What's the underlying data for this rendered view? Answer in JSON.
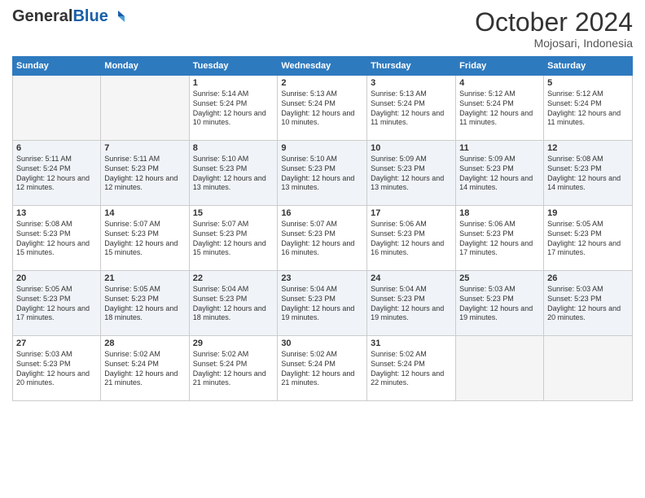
{
  "header": {
    "logo_general": "General",
    "logo_blue": "Blue",
    "month": "October 2024",
    "location": "Mojosari, Indonesia"
  },
  "days_of_week": [
    "Sunday",
    "Monday",
    "Tuesday",
    "Wednesday",
    "Thursday",
    "Friday",
    "Saturday"
  ],
  "weeks": [
    [
      {
        "day": "",
        "sunrise": "",
        "sunset": "",
        "daylight": ""
      },
      {
        "day": "",
        "sunrise": "",
        "sunset": "",
        "daylight": ""
      },
      {
        "day": "1",
        "sunrise": "Sunrise: 5:14 AM",
        "sunset": "Sunset: 5:24 PM",
        "daylight": "Daylight: 12 hours and 10 minutes."
      },
      {
        "day": "2",
        "sunrise": "Sunrise: 5:13 AM",
        "sunset": "Sunset: 5:24 PM",
        "daylight": "Daylight: 12 hours and 10 minutes."
      },
      {
        "day": "3",
        "sunrise": "Sunrise: 5:13 AM",
        "sunset": "Sunset: 5:24 PM",
        "daylight": "Daylight: 12 hours and 11 minutes."
      },
      {
        "day": "4",
        "sunrise": "Sunrise: 5:12 AM",
        "sunset": "Sunset: 5:24 PM",
        "daylight": "Daylight: 12 hours and 11 minutes."
      },
      {
        "day": "5",
        "sunrise": "Sunrise: 5:12 AM",
        "sunset": "Sunset: 5:24 PM",
        "daylight": "Daylight: 12 hours and 11 minutes."
      }
    ],
    [
      {
        "day": "6",
        "sunrise": "Sunrise: 5:11 AM",
        "sunset": "Sunset: 5:24 PM",
        "daylight": "Daylight: 12 hours and 12 minutes."
      },
      {
        "day": "7",
        "sunrise": "Sunrise: 5:11 AM",
        "sunset": "Sunset: 5:23 PM",
        "daylight": "Daylight: 12 hours and 12 minutes."
      },
      {
        "day": "8",
        "sunrise": "Sunrise: 5:10 AM",
        "sunset": "Sunset: 5:23 PM",
        "daylight": "Daylight: 12 hours and 13 minutes."
      },
      {
        "day": "9",
        "sunrise": "Sunrise: 5:10 AM",
        "sunset": "Sunset: 5:23 PM",
        "daylight": "Daylight: 12 hours and 13 minutes."
      },
      {
        "day": "10",
        "sunrise": "Sunrise: 5:09 AM",
        "sunset": "Sunset: 5:23 PM",
        "daylight": "Daylight: 12 hours and 13 minutes."
      },
      {
        "day": "11",
        "sunrise": "Sunrise: 5:09 AM",
        "sunset": "Sunset: 5:23 PM",
        "daylight": "Daylight: 12 hours and 14 minutes."
      },
      {
        "day": "12",
        "sunrise": "Sunrise: 5:08 AM",
        "sunset": "Sunset: 5:23 PM",
        "daylight": "Daylight: 12 hours and 14 minutes."
      }
    ],
    [
      {
        "day": "13",
        "sunrise": "Sunrise: 5:08 AM",
        "sunset": "Sunset: 5:23 PM",
        "daylight": "Daylight: 12 hours and 15 minutes."
      },
      {
        "day": "14",
        "sunrise": "Sunrise: 5:07 AM",
        "sunset": "Sunset: 5:23 PM",
        "daylight": "Daylight: 12 hours and 15 minutes."
      },
      {
        "day": "15",
        "sunrise": "Sunrise: 5:07 AM",
        "sunset": "Sunset: 5:23 PM",
        "daylight": "Daylight: 12 hours and 15 minutes."
      },
      {
        "day": "16",
        "sunrise": "Sunrise: 5:07 AM",
        "sunset": "Sunset: 5:23 PM",
        "daylight": "Daylight: 12 hours and 16 minutes."
      },
      {
        "day": "17",
        "sunrise": "Sunrise: 5:06 AM",
        "sunset": "Sunset: 5:23 PM",
        "daylight": "Daylight: 12 hours and 16 minutes."
      },
      {
        "day": "18",
        "sunrise": "Sunrise: 5:06 AM",
        "sunset": "Sunset: 5:23 PM",
        "daylight": "Daylight: 12 hours and 17 minutes."
      },
      {
        "day": "19",
        "sunrise": "Sunrise: 5:05 AM",
        "sunset": "Sunset: 5:23 PM",
        "daylight": "Daylight: 12 hours and 17 minutes."
      }
    ],
    [
      {
        "day": "20",
        "sunrise": "Sunrise: 5:05 AM",
        "sunset": "Sunset: 5:23 PM",
        "daylight": "Daylight: 12 hours and 17 minutes."
      },
      {
        "day": "21",
        "sunrise": "Sunrise: 5:05 AM",
        "sunset": "Sunset: 5:23 PM",
        "daylight": "Daylight: 12 hours and 18 minutes."
      },
      {
        "day": "22",
        "sunrise": "Sunrise: 5:04 AM",
        "sunset": "Sunset: 5:23 PM",
        "daylight": "Daylight: 12 hours and 18 minutes."
      },
      {
        "day": "23",
        "sunrise": "Sunrise: 5:04 AM",
        "sunset": "Sunset: 5:23 PM",
        "daylight": "Daylight: 12 hours and 19 minutes."
      },
      {
        "day": "24",
        "sunrise": "Sunrise: 5:04 AM",
        "sunset": "Sunset: 5:23 PM",
        "daylight": "Daylight: 12 hours and 19 minutes."
      },
      {
        "day": "25",
        "sunrise": "Sunrise: 5:03 AM",
        "sunset": "Sunset: 5:23 PM",
        "daylight": "Daylight: 12 hours and 19 minutes."
      },
      {
        "day": "26",
        "sunrise": "Sunrise: 5:03 AM",
        "sunset": "Sunset: 5:23 PM",
        "daylight": "Daylight: 12 hours and 20 minutes."
      }
    ],
    [
      {
        "day": "27",
        "sunrise": "Sunrise: 5:03 AM",
        "sunset": "Sunset: 5:23 PM",
        "daylight": "Daylight: 12 hours and 20 minutes."
      },
      {
        "day": "28",
        "sunrise": "Sunrise: 5:02 AM",
        "sunset": "Sunset: 5:24 PM",
        "daylight": "Daylight: 12 hours and 21 minutes."
      },
      {
        "day": "29",
        "sunrise": "Sunrise: 5:02 AM",
        "sunset": "Sunset: 5:24 PM",
        "daylight": "Daylight: 12 hours and 21 minutes."
      },
      {
        "day": "30",
        "sunrise": "Sunrise: 5:02 AM",
        "sunset": "Sunset: 5:24 PM",
        "daylight": "Daylight: 12 hours and 21 minutes."
      },
      {
        "day": "31",
        "sunrise": "Sunrise: 5:02 AM",
        "sunset": "Sunset: 5:24 PM",
        "daylight": "Daylight: 12 hours and 22 minutes."
      },
      {
        "day": "",
        "sunrise": "",
        "sunset": "",
        "daylight": ""
      },
      {
        "day": "",
        "sunrise": "",
        "sunset": "",
        "daylight": ""
      }
    ]
  ]
}
